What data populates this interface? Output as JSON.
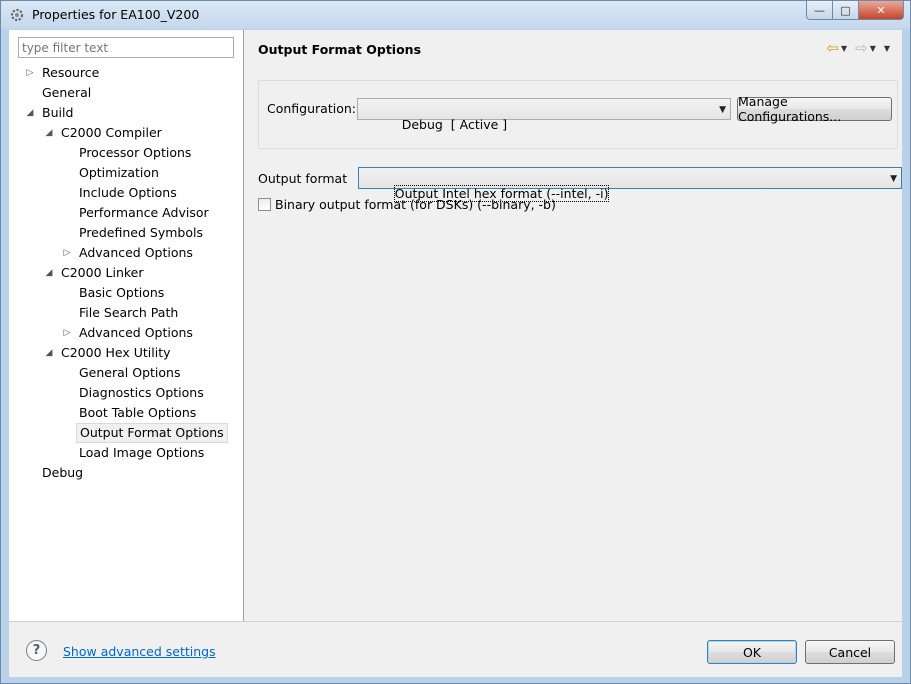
{
  "window": {
    "title": "Properties for EA100_V200",
    "buttons": {
      "minimize": "—",
      "maximize": "□",
      "close": "✕"
    }
  },
  "filter": {
    "placeholder": "type filter text",
    "value": ""
  },
  "tree": [
    {
      "label": "Resource",
      "level": 0,
      "twisty": "collapsed"
    },
    {
      "label": "General",
      "level": 0,
      "twisty": "none"
    },
    {
      "label": "Build",
      "level": 0,
      "twisty": "expanded"
    },
    {
      "label": "C2000 Compiler",
      "level": 1,
      "twisty": "expanded"
    },
    {
      "label": "Processor Options",
      "level": 2,
      "twisty": "none"
    },
    {
      "label": "Optimization",
      "level": 2,
      "twisty": "none"
    },
    {
      "label": "Include Options",
      "level": 2,
      "twisty": "none"
    },
    {
      "label": "Performance Advisor",
      "level": 2,
      "twisty": "none"
    },
    {
      "label": "Predefined Symbols",
      "level": 2,
      "twisty": "none"
    },
    {
      "label": "Advanced Options",
      "level": 2,
      "twisty": "collapsed"
    },
    {
      "label": "C2000 Linker",
      "level": 1,
      "twisty": "expanded"
    },
    {
      "label": "Basic Options",
      "level": 2,
      "twisty": "none"
    },
    {
      "label": "File Search Path",
      "level": 2,
      "twisty": "none"
    },
    {
      "label": "Advanced Options",
      "level": 2,
      "twisty": "collapsed"
    },
    {
      "label": "C2000 Hex Utility",
      "level": 1,
      "twisty": "expanded"
    },
    {
      "label": "General Options",
      "level": 2,
      "twisty": "none"
    },
    {
      "label": "Diagnostics Options",
      "level": 2,
      "twisty": "none"
    },
    {
      "label": "Boot Table Options",
      "level": 2,
      "twisty": "none"
    },
    {
      "label": "Output Format Options",
      "level": 2,
      "twisty": "none",
      "selected": true
    },
    {
      "label": "Load Image Options",
      "level": 2,
      "twisty": "none"
    },
    {
      "label": "Debug",
      "level": 0,
      "twisty": "none"
    }
  ],
  "page": {
    "title": "Output Format Options",
    "configuration_label": "Configuration:",
    "configuration_value": "Debug  [ Active ]",
    "manage_button": "Manage Configurations...",
    "output_format_label": "Output format",
    "output_format_value": "Output Intel hex format (--intel, -i)",
    "binary_checkbox_label": "Binary output format (for DSKs) (--binary, -b)",
    "binary_checked": false
  },
  "footer": {
    "help_icon": "?",
    "advanced_link": "Show advanced settings",
    "ok_button": "OK",
    "cancel_button": "Cancel"
  },
  "icons": {
    "back": "⇦",
    "forward": "⇨",
    "dropdown": "▼"
  }
}
